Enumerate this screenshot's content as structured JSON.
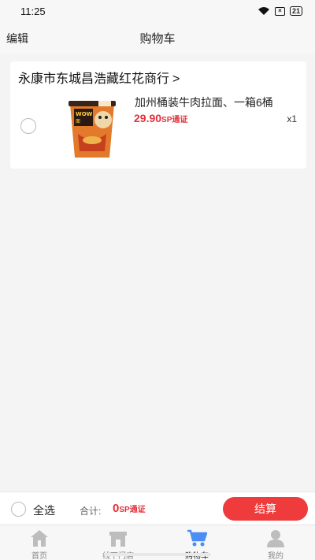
{
  "status_bar": {
    "time": "11:25",
    "battery": "21"
  },
  "header": {
    "edit_label": "编辑",
    "title": "购物车"
  },
  "store": {
    "name": "永康市东城昌浩藏红花商行",
    "chevron": ">",
    "item": {
      "name": "加州桶装牛肉拉面、一箱6桶",
      "price": "29.90",
      "price_unit": "SP通证",
      "quantity": "x1",
      "image_icon": "instant-noodle-bucket",
      "checked": false
    }
  },
  "checkout": {
    "select_all_label": "全选",
    "total_label": "合计:",
    "total_value": "0",
    "total_unit": "SP通证",
    "button_label": "结算",
    "accent_color": "#ef3b3b"
  },
  "tabs": [
    {
      "label": "首页",
      "icon": "home-icon",
      "active": false
    },
    {
      "label": "线下门店",
      "icon": "store-icon",
      "active": false
    },
    {
      "label": "购物车",
      "icon": "cart-icon",
      "active": true
    },
    {
      "label": "我的",
      "icon": "user-icon",
      "active": false
    }
  ]
}
